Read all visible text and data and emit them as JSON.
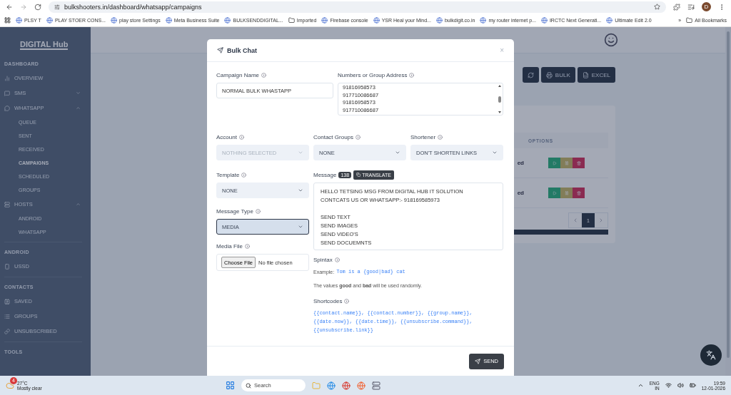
{
  "browser": {
    "url": "bulkshooters.in/dashboard/whatsapp/campaigns",
    "profile": "D",
    "bookmarks": [
      {
        "label": "PLSY T",
        "kind": "site"
      },
      {
        "label": "PLAY STOER CONS...",
        "kind": "site"
      },
      {
        "label": "play store Settings",
        "kind": "site"
      },
      {
        "label": "Meta Business Suite",
        "kind": "site"
      },
      {
        "label": "BULKSENDDIGITAL...",
        "kind": "site"
      },
      {
        "label": "Imported",
        "kind": "folder"
      },
      {
        "label": "Firebase console",
        "kind": "site"
      },
      {
        "label": "YSR Heal your Mind...",
        "kind": "site"
      },
      {
        "label": "bulkdigit.co.in",
        "kind": "site"
      },
      {
        "label": "my router internet p...",
        "kind": "site"
      },
      {
        "label": "IRCTC Next Generati...",
        "kind": "site"
      },
      {
        "label": "Ultimate Edit 2.0",
        "kind": "site"
      }
    ],
    "more": "»",
    "all_bookmarks": "All Bookmarks"
  },
  "sidebar": {
    "logo": "DIGITAL Hub",
    "sections": [
      {
        "title": "DASHBOARD",
        "items": [
          {
            "label": "OVERVIEW",
            "selected": false
          },
          {
            "label": "SMS",
            "selected": false,
            "expanded": false
          },
          {
            "label": "WHATSAPP",
            "selected": false,
            "expanded": true,
            "children": [
              {
                "label": "QUEUE",
                "selected": false
              },
              {
                "label": "SENT",
                "selected": false
              },
              {
                "label": "RECEIVED",
                "selected": false
              },
              {
                "label": "CAMPAIGNS",
                "selected": true
              },
              {
                "label": "SCHEDULED",
                "selected": false
              },
              {
                "label": "GROUPS",
                "selected": false
              }
            ]
          },
          {
            "label": "HOSTS",
            "selected": false,
            "expanded": true,
            "children": [
              {
                "label": "ANDROID",
                "selected": false
              },
              {
                "label": "WHATSAPP",
                "selected": false
              }
            ]
          }
        ]
      },
      {
        "title": "ANDROID",
        "items": [
          {
            "label": "USSD",
            "selected": false
          }
        ]
      },
      {
        "title": "CONTACTS",
        "items": [
          {
            "label": "SAVED",
            "selected": false
          },
          {
            "label": "GROUPS",
            "selected": false
          },
          {
            "label": "UNSUBSCRIBED",
            "selected": false
          }
        ]
      },
      {
        "title": "TOOLS"
      }
    ]
  },
  "page": {
    "toolbar_buttons": [
      "BULK",
      "EXCEL"
    ],
    "table": {
      "columns": [
        "OPTIONS"
      ],
      "rows": [
        {
          "status": "ed"
        },
        {
          "status": "ed"
        }
      ]
    },
    "pagination": [
      {
        "label": "1",
        "selected": true
      }
    ]
  },
  "modal": {
    "title": "Bulk Chat",
    "close": "×",
    "campaign_name": {
      "label": "Campaign Name",
      "value": "NORMAL BULK WHASTAPP"
    },
    "numbers": {
      "label": "Numbers or Group Address",
      "value": "91816958573\n917710086687\n91816958573\n917710086687"
    },
    "selects": [
      {
        "label": "Account",
        "value": "NOTHING SELECTED",
        "disabled": true,
        "focused": false
      },
      {
        "label": "Contact Groups",
        "value": "NONE",
        "disabled": false,
        "focused": false
      },
      {
        "label": "Shortener",
        "value": "DON'T SHORTEN LINKS",
        "disabled": false,
        "focused": false
      }
    ],
    "template": {
      "label": "Template",
      "value": "NONE",
      "disabled": false,
      "focused": false
    },
    "message_type": {
      "label": "Message Type",
      "value": "MEDIA",
      "disabled": false,
      "focused": true
    },
    "media_file": {
      "label": "Media File",
      "button": "Choose File",
      "status": "No file chosen"
    },
    "message": {
      "label": "Message",
      "count": "138",
      "translate": "TRANSLATE",
      "value": "HELLO TETSING MSG FROM DIGITAL HUB IT SOLUTION\nCONTCATS US OR WHATSAPP:- 918169585973\n\nSEND TEXT\nSEND IMAGES\nSEND VIDEO'S\nSEND DOCUEMNTS"
    },
    "spintax": {
      "label": "Spintax",
      "example_label": "Example:",
      "example": "Tom is a {good|bad} cat",
      "note": "The values **good** and **bad** will be used randomly."
    },
    "shortcodes": {
      "label": "Shortcodes",
      "text": "{{contact.name}}, {{contact.number}}, {{group.name}}, {{date.now}}, {{date.time}}, {{unsubscribe.command}}, {{unsubscribe.link}}"
    },
    "send": "SEND"
  },
  "taskbar": {
    "weather_badge": "4",
    "temperature": "27°C",
    "condition": "Mostly clear",
    "search": {
      "placeholder": "Search"
    },
    "language": "ENG",
    "region": "IN",
    "time": "19:59",
    "date": "12-01-2026"
  }
}
